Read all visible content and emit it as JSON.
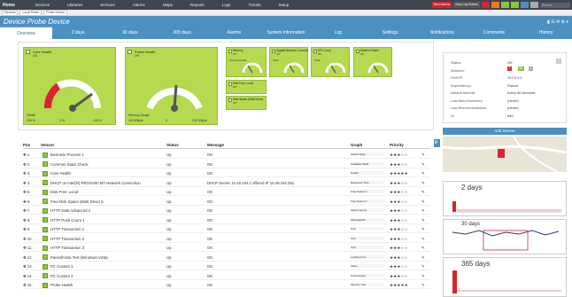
{
  "nav": {
    "logo": "Home",
    "items": [
      "Devices",
      "Libraries",
      "Sensors",
      "Alarms",
      "Maps",
      "Reports",
      "Logs",
      "Tickets",
      "Setup"
    ],
    "badges": [
      {
        "label": "New Alarms",
        "color": "#d9232d"
      },
      {
        "label": "New Log Entries",
        "color": "#555"
      },
      {
        "label": "",
        "color": "#d9232d"
      },
      {
        "label": "",
        "color": "#e87c1e"
      },
      {
        "label": "",
        "color": "#8dc63f"
      },
      {
        "label": "",
        "color": "#8dc63f"
      },
      {
        "label": "",
        "color": "#4b90c2"
      },
      {
        "label": "",
        "color": "#aaa"
      }
    ],
    "search_placeholder": "Search"
  },
  "breadcrumb": [
    "Devices",
    "Local Probe",
    "Probe Device"
  ],
  "page": {
    "title": "Device Probe Device",
    "tabs": [
      {
        "label": "Overview",
        "active": true
      },
      {
        "label": "2 days"
      },
      {
        "label": "30 days"
      },
      {
        "label": "365 days"
      },
      {
        "label": "Alarms"
      },
      {
        "label": "System Information"
      },
      {
        "label": "Log"
      },
      {
        "label": "Settings"
      },
      {
        "label": "Notifications"
      },
      {
        "label": "Comments"
      },
      {
        "label": "History"
      }
    ]
  },
  "gauges": {
    "core_health": {
      "title": "Core Health",
      "status": "OK",
      "foot1": "Health",
      "foot2": "100 %",
      "scale_min": "0 %",
      "scale_max": "100 %"
    },
    "probe_health": {
      "title": "Probe Health",
      "status": "OK",
      "foot1": "Memory Usage",
      "foot2": "109 MByte",
      "scale_min": "0",
      "scale_max": "210 MByte"
    },
    "small": [
      {
        "title": "Memory",
        "status": "OK",
        "sub": "Percent Availa"
      },
      {
        "title": "Gigabit Network Connecti...",
        "status": "OK",
        "sub": "Total"
      },
      {
        "title": "CPU Load",
        "status": "OK",
        "sub": "Total"
      },
      {
        "title": "System Health",
        "status": "OK",
        "sub": ""
      },
      {
        "title": "Disk Free: Local",
        "status": "OK",
        "sub": ""
      },
      {
        "title": "Disk Space (Multi Drive)",
        "status": "OK",
        "sub": ""
      }
    ]
  },
  "details": {
    "rows": [
      {
        "label": "Status:",
        "value": "OK"
      },
      {
        "label": "Sensors:",
        "value": ""
      },
      {
        "label": "DNS/IP:",
        "value": "127.0.0.1"
      },
      {
        "label": "Dependency:",
        "value": "Parent"
      },
      {
        "label": "Default Interval:",
        "value": "every 60 seconds"
      },
      {
        "label": "Last Auto-Discovery:",
        "value": "(never)"
      },
      {
        "label": "Last Recommendation:",
        "value": "(never)"
      },
      {
        "label": "ID:",
        "value": "#40"
      }
    ],
    "sensor_counts": [
      {
        "count": "1",
        "color": "#d9232d"
      },
      {
        "count": "34",
        "color": "#8dc63f"
      },
      {
        "count": "1",
        "color": "#aaa"
      }
    ]
  },
  "add_sensor_label": "Add Sensor",
  "table": {
    "headers": {
      "pos": "Pos",
      "sensor": "Sensor",
      "status": "Status",
      "message": "Message",
      "graph": "Graph",
      "priority": "Priority"
    },
    "rows": [
      {
        "pos": "1.",
        "sensor": "Business Process 1",
        "status": "Up",
        "message": "OK",
        "graph": "Global State",
        "stars": "★★★☆☆"
      },
      {
        "pos": "2.",
        "sensor": "Common SaaS Check",
        "status": "Up",
        "message": "OK",
        "graph": "Available SaaS",
        "stars": "★★★☆☆"
      },
      {
        "pos": "3.",
        "sensor": "Core Health",
        "status": "Up",
        "message": "OK",
        "graph": "Health",
        "stars": "★★★★★"
      },
      {
        "pos": "4.",
        "sensor": "DHCP on Intel(R) PRO/1000 MT Network Connection",
        "status": "Up",
        "message": "DHCP Server 10.49.194.1 offered IP 10.49.194.251",
        "graph": "Response Time",
        "stars": "★★★☆☆"
      },
      {
        "pos": "5.",
        "sensor": "Disk Free: Local",
        "status": "Up",
        "message": "OK",
        "graph": "Free Space C:",
        "stars": "★★★☆☆"
      },
      {
        "pos": "6.",
        "sensor": "Free Disk Space (Multi Drive) 5",
        "status": "Up",
        "message": "OK",
        "graph": "Free Space C:",
        "stars": "★★★☆☆"
      },
      {
        "pos": "7.",
        "sensor": "HTTP Data Advanced 2",
        "status": "Up",
        "message": "OK",
        "graph": "Total property",
        "stars": "★★★☆☆"
      },
      {
        "pos": "8.",
        "sensor": "HTTP Push Count 1",
        "status": "Up",
        "message": "OK",
        "graph": "Messages/hr",
        "stars": "★★★☆☆"
      },
      {
        "pos": "9.",
        "sensor": "HTTP Transaction 1",
        "status": "Up",
        "message": "OK",
        "graph": "Sum",
        "stars": "★★★☆☆"
      },
      {
        "pos": "10.",
        "sensor": "HTTP Transaction 2",
        "status": "Up",
        "message": "OK",
        "graph": "Sum",
        "stars": "★★★☆☆"
      },
      {
        "pos": "11.",
        "sensor": "HTTP Transaction 3",
        "status": "Up",
        "message": "OK",
        "graph": "Sum",
        "stars": "★★★☆☆"
      },
      {
        "pos": "12.",
        "sensor": "Paessl/Vista Test (Windows Vista)",
        "status": "Up",
        "message": "OK",
        "graph": "Loading time",
        "stars": "★★★☆☆"
      },
      {
        "pos": "13.",
        "sensor": "PC Custom 1",
        "status": "Up",
        "message": "OK",
        "graph": "Value",
        "stars": "★★★☆☆"
      },
      {
        "pos": "14.",
        "sensor": "PC Custom 2",
        "status": "Up",
        "message": "OK",
        "graph": "% Processor",
        "stars": "★★★☆☆"
      },
      {
        "pos": "15.",
        "sensor": "Probe Health",
        "status": "Up",
        "message": "OK",
        "graph": "Memory Usa",
        "stars": "★★★★★"
      }
    ]
  },
  "graphs": [
    {
      "label": "2 days"
    },
    {
      "label": "30 days"
    },
    {
      "label": "365 days"
    }
  ]
}
